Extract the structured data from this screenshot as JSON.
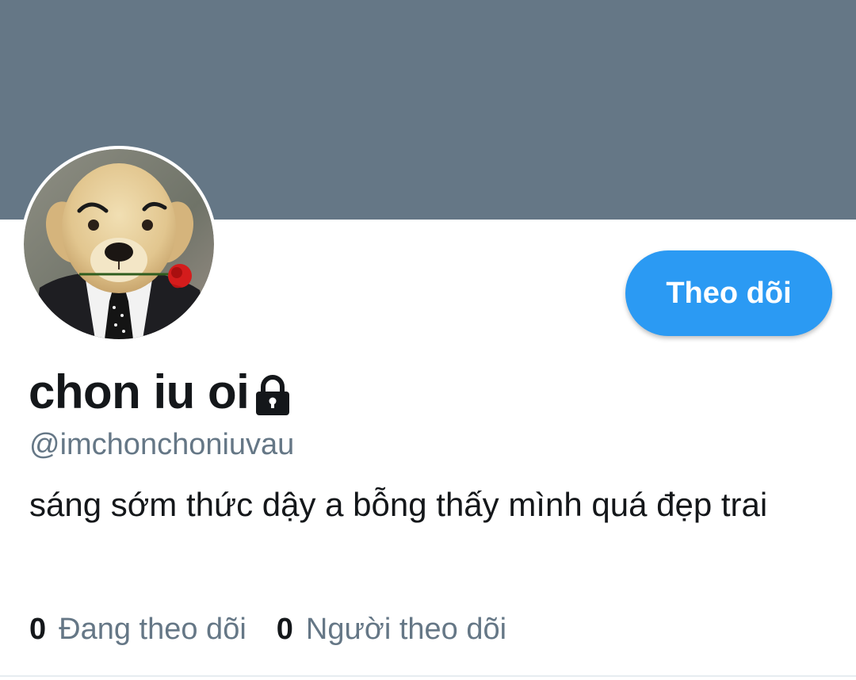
{
  "colors": {
    "banner": "#657786",
    "accent": "#1da1f2",
    "follow_button_bg": "#2b9af3",
    "text_primary": "#14171a",
    "text_secondary": "#657786"
  },
  "profile": {
    "display_name": "chon iu oi",
    "protected_icon": "lock-icon",
    "handle": "@imchonchoniuvau",
    "bio": "sáng sớm thức dậy a bỗng thấy mình quá đẹp trai",
    "avatar": "dog-in-suit-holding-rose"
  },
  "actions": {
    "follow_label": "Theo dõi"
  },
  "stats": {
    "following_count": "0",
    "following_label": "Đang theo dõi",
    "followers_count": "0",
    "followers_label": "Người theo dõi"
  }
}
